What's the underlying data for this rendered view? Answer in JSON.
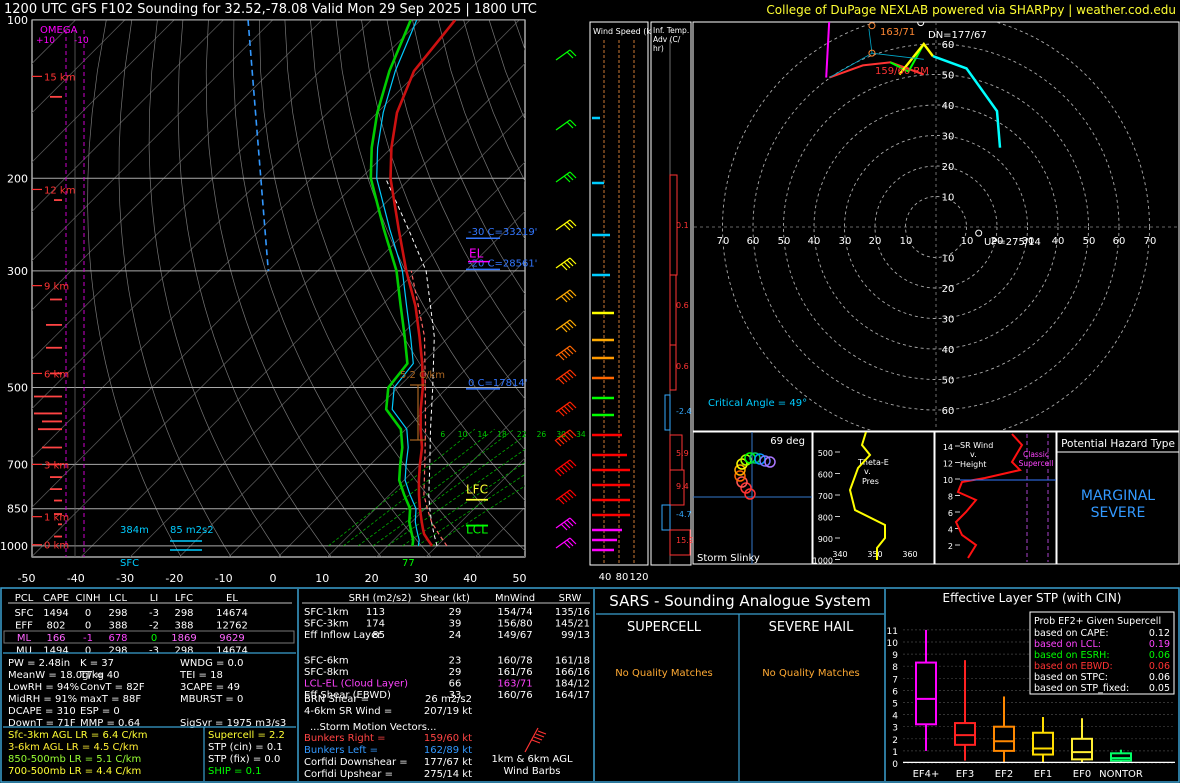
{
  "title": {
    "left": "1200 UTC GFS F102 Sounding for 32.52,-78.08 Valid  Mon 29 Sep 2025 | 1800 UTC",
    "right": "College of DuPage NEXLAB powered via SHARPpy | weather.cod.edu"
  },
  "skewt": {
    "pressure_ticks": [
      {
        "p": 100,
        "label": "100"
      },
      {
        "p": 200,
        "label": "200"
      },
      {
        "p": 300,
        "label": "300"
      },
      {
        "p": 500,
        "label": "500"
      },
      {
        "p": 700,
        "label": "700"
      },
      {
        "p": 850,
        "label": "850"
      },
      {
        "p": 1000,
        "label": "1000"
      }
    ],
    "temp_ticks": [
      "-50",
      "-40",
      "-30",
      "-20",
      "-10",
      "0",
      "10",
      "20",
      "30",
      "40",
      "50"
    ],
    "height_labels": [
      {
        "p": 128,
        "label": "15 km"
      },
      {
        "p": 210,
        "label": "12 km"
      },
      {
        "p": 320,
        "label": "9 km"
      },
      {
        "p": 470,
        "label": "6 km"
      },
      {
        "p": 700,
        "label": "3 km"
      },
      {
        "p": 880,
        "label": "1 km"
      },
      {
        "p": 995,
        "label": "0 km"
      }
    ],
    "omega_label": "OMEGA",
    "omega_ticks": [
      "+10",
      "-10"
    ],
    "annotations": {
      "neg30": "-30 C=33219'",
      "neg20": "-20 C=28561'",
      "zero": "0 C=17814'",
      "el": "EL",
      "lfc": "LFC",
      "lcl": "LCL",
      "lapse": "5.2 C/km",
      "srh_depth": "384m",
      "srh_val": "85 m2s2",
      "sfc": "SFC",
      "sfc_temp": "77",
      "mixing": [
        "6",
        "10",
        "14",
        "18",
        "22",
        "26",
        "30",
        "34"
      ]
    }
  },
  "wind_speed": {
    "title": "Wind Speed (knots)",
    "ticks": [
      "40",
      "80",
      "120"
    ]
  },
  "temp_adv": {
    "title": "Inf. Temp. Adv (C/hr)",
    "values": [
      "0.1",
      "0.6",
      "0.6",
      "-2.4",
      "5.9",
      "9.4",
      "-4.7",
      "15.9"
    ]
  },
  "hodograph": {
    "rings": [
      "10",
      "20",
      "30",
      "40",
      "50",
      "60"
    ],
    "axis_labels": [
      "70",
      "60",
      "50",
      "40",
      "30",
      "20",
      "10",
      "10",
      "20",
      "30",
      "40",
      "50",
      "60",
      "70"
    ],
    "dn": "DN=177/67",
    "bunkers_right": "159/60 RM",
    "lm": "163/71",
    "up": "UP=275/14",
    "critical_angle": "Critical Angle = 49°"
  },
  "slinky": {
    "title": "Storm Slinky",
    "angle": "69 deg"
  },
  "theta": {
    "title": "Theta-E v. Pres",
    "yticks": [
      "500",
      "600",
      "700",
      "800",
      "900",
      "1000"
    ],
    "xticks": [
      "340",
      "350",
      "360"
    ]
  },
  "srwind": {
    "title": "SR Wind v. Height",
    "yticks": [
      "14",
      "12",
      "10",
      "8",
      "6",
      "4",
      "2"
    ],
    "label": "Classic Supercell"
  },
  "hazard": {
    "title": "Potential Hazard Type",
    "value": "MARGINAL SEVERE"
  },
  "parcels": {
    "headers": [
      "PCL",
      "CAPE",
      "CINH",
      "LCL",
      "LI",
      "LFC",
      "EL"
    ],
    "rows": [
      [
        "SFC",
        "1494",
        "0",
        "298",
        "-3",
        "298",
        "14674"
      ],
      [
        "EFF",
        "802",
        "0",
        "388",
        "-2",
        "388",
        "12762"
      ],
      [
        "ML",
        "166",
        "-1",
        "678",
        "0",
        "1869",
        "9629"
      ],
      [
        "MU",
        "1494",
        "0",
        "298",
        "-3",
        "298",
        "14674"
      ]
    ]
  },
  "indices": [
    [
      "PW = 2.48in",
      "K = 37",
      "WNDG = 0.0"
    ],
    [
      "MeanW = 18.0g/kg",
      "TT = 40",
      "TEI = 18"
    ],
    [
      "LowRH = 94%",
      "ConvT = 82F",
      "3CAPE = 49"
    ],
    [
      "MidRH = 91%",
      "maxT = 88F",
      "MBURST = 0"
    ],
    [
      "DCAPE = 310",
      "ESP = 0",
      ""
    ],
    [
      "DownT = 71F",
      "MMP = 0.64",
      "SigSvr = 1975 m3/s3"
    ]
  ],
  "lapse": [
    "Sfc-3km AGL LR = 6.4 C/km",
    "3-6km AGL LR = 4.5 C/km",
    "850-500mb LR = 5.1 C/km",
    "700-500mb LR = 4.4 C/km"
  ],
  "composite": [
    "Supercell = 2.2",
    "STP (cin) = 0.1",
    "STP (fix) = 0.0",
    "SHIP = 0.1"
  ],
  "kinematics": {
    "headers": [
      "SRH (m2/s2)",
      "Shear (kt)",
      "MnWind",
      "SRW"
    ],
    "rows": [
      [
        "SFC-1km",
        "113",
        "29",
        "154/74",
        "135/16"
      ],
      [
        "SFC-3km",
        "174",
        "39",
        "156/80",
        "145/21"
      ],
      [
        "Eff Inflow Layer",
        "85",
        "24",
        "149/67",
        "99/13"
      ],
      [
        "",
        "",
        "",
        "",
        ""
      ],
      [
        "SFC-6km",
        "",
        "23",
        "160/78",
        "161/18"
      ],
      [
        "SFC-8km",
        "",
        "29",
        "161/76",
        "166/16"
      ],
      [
        "LCL-EL (Cloud Layer)",
        "",
        "66",
        "163/71",
        "184/12"
      ],
      [
        "Eff Shear (EBWD)",
        "",
        "33",
        "160/76",
        "164/17"
      ]
    ],
    "brn": [
      "BRN Shear =",
      "26 m2/s2"
    ],
    "sr46": [
      "4-6km SR Wind =",
      "207/19 kt"
    ],
    "storm_motion": "...Storm Motion Vectors...",
    "vectors": [
      [
        "Bunkers Right =",
        "159/60 kt"
      ],
      [
        "Bunkers Left =",
        "162/89 kt"
      ],
      [
        "Corfidi Downshear =",
        "177/67 kt"
      ],
      [
        "Corfidi Upshear =",
        "275/14 kt"
      ]
    ],
    "barbs_label": "1km & 6km AGL Wind Barbs"
  },
  "sars": {
    "title": "SARS - Sounding Analogue System",
    "supercell": "SUPERCELL",
    "hail": "SEVERE HAIL",
    "no_match": "No Quality Matches"
  },
  "stp": {
    "title": "Effective Layer STP (with CIN)",
    "yticks": [
      "11",
      "10",
      "9",
      "8",
      "7",
      "6",
      "5",
      "4",
      "3",
      "2",
      "1",
      "0"
    ],
    "categories": [
      "EF4+",
      "EF3",
      "EF2",
      "EF1",
      "EF0",
      "NONTOR"
    ],
    "prob_title": "Prob EF2+ Given Supercell",
    "probs": [
      [
        "based on CAPE:",
        "0.12"
      ],
      [
        "based on LCL:",
        "0.19"
      ],
      [
        "based on ESRH:",
        "0.06"
      ],
      [
        "based on EBWD:",
        "0.06"
      ],
      [
        "based on STPC:",
        "0.06"
      ],
      [
        "based on STP_fixed:",
        "0.05"
      ]
    ],
    "colors": [
      "#ff00ff",
      "#ff2222",
      "#ff8800",
      "#ffdd00",
      "#ffee33",
      "#00ff66"
    ]
  }
}
